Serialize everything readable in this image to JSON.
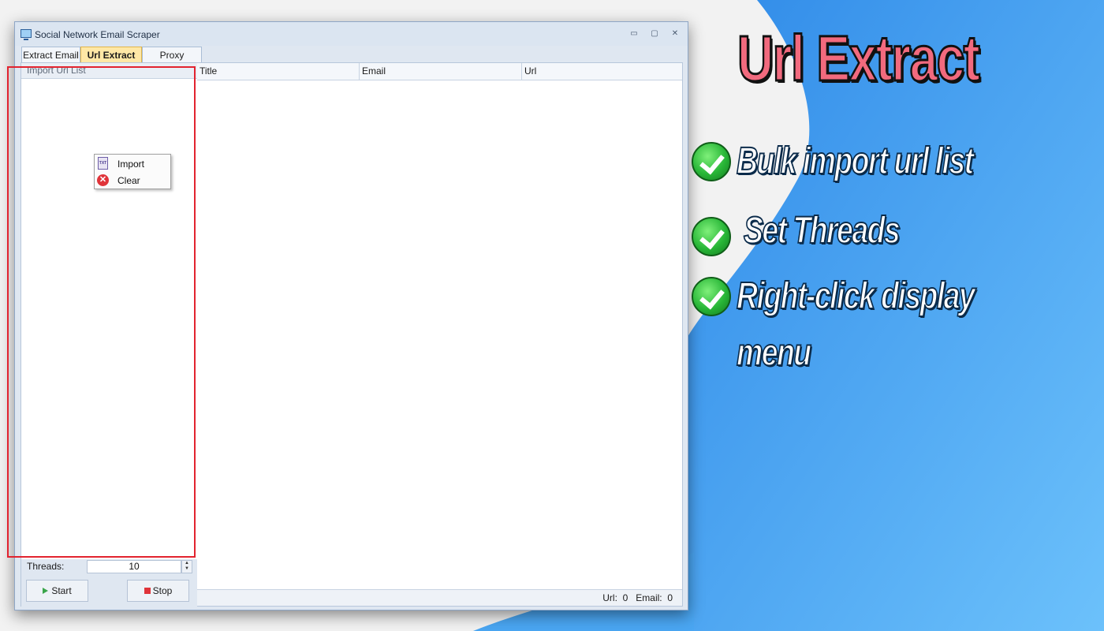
{
  "window": {
    "title": "Social Network Email Scraper",
    "controls": {
      "minimize": "▭",
      "restore": "▢",
      "close": "✕"
    }
  },
  "tabs": [
    {
      "label": "Extract Email",
      "active": false
    },
    {
      "label": "Url Extract",
      "active": true
    },
    {
      "label": "Proxy",
      "active": false
    }
  ],
  "import_panel": {
    "header": "Import Url List"
  },
  "context_menu": {
    "items": [
      {
        "label": "Import",
        "icon": "txt-file-icon"
      },
      {
        "label": "Clear",
        "icon": "clear-icon"
      }
    ]
  },
  "threads": {
    "label": "Threads:",
    "value": "10"
  },
  "buttons": {
    "start": "Start",
    "stop": "Stop"
  },
  "grid": {
    "columns": [
      "Title",
      "Email",
      "Url"
    ]
  },
  "status": {
    "url_label": "Url:",
    "url_count": "0",
    "email_label": "Email:",
    "email_count": "0"
  },
  "promo": {
    "title": "Url Extract",
    "features": [
      "Bulk import url list",
      "Set Threads",
      "Right-click display",
      "menu"
    ]
  },
  "colors": {
    "accent_red": "#e2232f",
    "tab_active": "#ffe8a6",
    "promo_title": "#f26a7e",
    "background_blue": "#3d95ee"
  }
}
